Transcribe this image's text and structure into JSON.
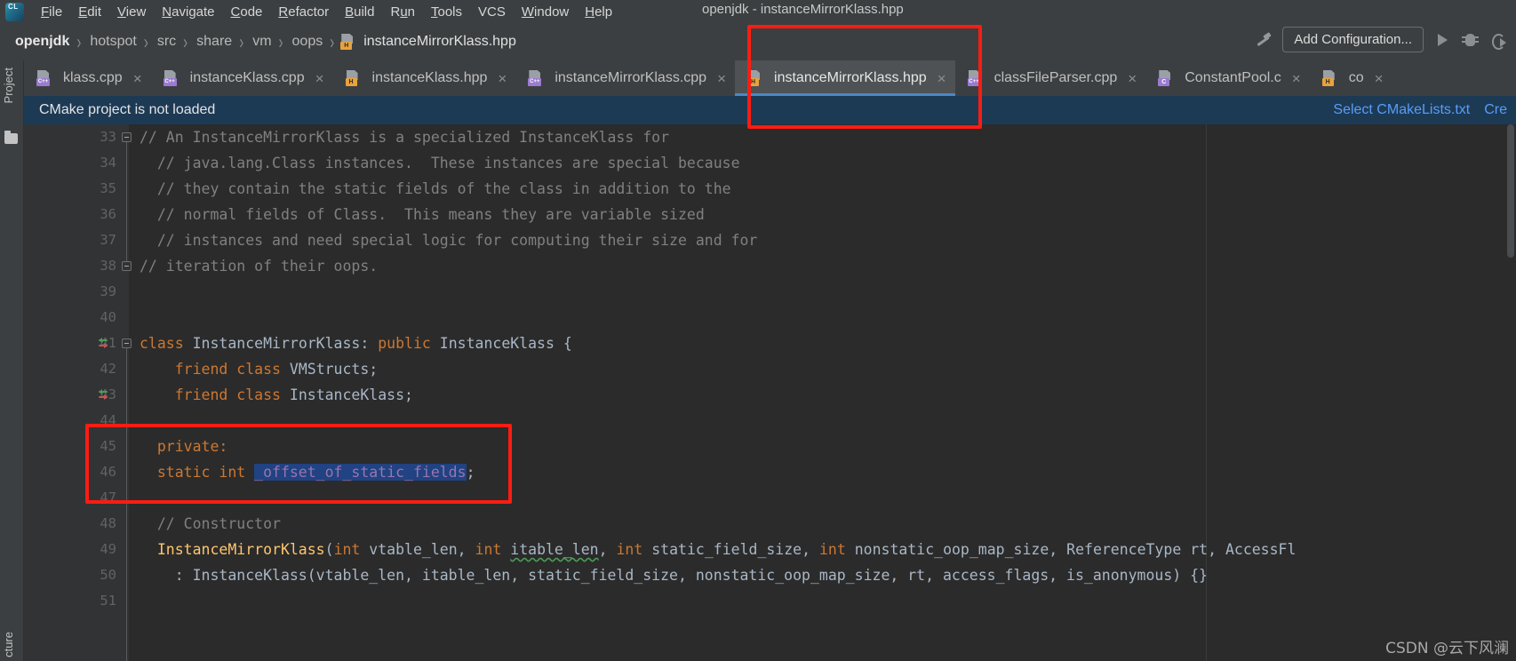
{
  "window": {
    "title": "openjdk - instanceMirrorKlass.hpp"
  },
  "menu": {
    "items": [
      {
        "label": "File",
        "mnemonic": "F"
      },
      {
        "label": "Edit",
        "mnemonic": "E"
      },
      {
        "label": "View",
        "mnemonic": "V"
      },
      {
        "label": "Navigate",
        "mnemonic": "N"
      },
      {
        "label": "Code",
        "mnemonic": "C"
      },
      {
        "label": "Refactor",
        "mnemonic": "R"
      },
      {
        "label": "Build",
        "mnemonic": "B"
      },
      {
        "label": "Run",
        "mnemonic": "u"
      },
      {
        "label": "Tools",
        "mnemonic": "T"
      },
      {
        "label": "VCS",
        "mnemonic": ""
      },
      {
        "label": "Window",
        "mnemonic": "W"
      },
      {
        "label": "Help",
        "mnemonic": "H"
      }
    ]
  },
  "breadcrumb": {
    "items": [
      "openjdk",
      "hotspot",
      "src",
      "share",
      "vm",
      "oops"
    ],
    "file": "instanceMirrorKlass.hpp",
    "separator": "›"
  },
  "toolbar": {
    "build_icon": "hammer-icon",
    "add_configuration": "Add Configuration...",
    "run_icon": "run-icon",
    "debug_icon": "debug-icon",
    "attach_icon": "attach-process-icon"
  },
  "tool_windows": {
    "project": "Project",
    "structure": "cture"
  },
  "tabs": [
    {
      "label": "klass.cpp",
      "type": "cpp",
      "active": false
    },
    {
      "label": "instanceKlass.cpp",
      "type": "cpp",
      "active": false
    },
    {
      "label": "instanceKlass.hpp",
      "type": "h",
      "active": false
    },
    {
      "label": "instanceMirrorKlass.cpp",
      "type": "cpp",
      "active": false
    },
    {
      "label": "instanceMirrorKlass.hpp",
      "type": "h",
      "active": true
    },
    {
      "label": "classFileParser.cpp",
      "type": "cpp",
      "active": false
    },
    {
      "label": "ConstantPool.c",
      "type": "c",
      "active": false
    },
    {
      "label": "co",
      "type": "h",
      "active": false
    }
  ],
  "notification": {
    "message": "CMake project is not loaded",
    "link_select": "Select CMakeLists.txt",
    "link_create": "Cre"
  },
  "editor": {
    "first_line_number": 33,
    "lines": [
      {
        "n": 33,
        "segments": [
          {
            "t": "// An InstanceMirrorKlass is a specialized InstanceKlass for",
            "c": "cmt"
          }
        ]
      },
      {
        "n": 34,
        "segments": [
          {
            "t": "  // java.lang.Class instances.  These instances are special because",
            "c": "cmt"
          }
        ]
      },
      {
        "n": 35,
        "segments": [
          {
            "t": "  // they contain the static fields of the class in addition to the",
            "c": "cmt"
          }
        ]
      },
      {
        "n": 36,
        "segments": [
          {
            "t": "  // normal fields of Class.  This means they are variable sized",
            "c": "cmt"
          }
        ]
      },
      {
        "n": 37,
        "segments": [
          {
            "t": "  // instances and need special logic for computing their size and for",
            "c": "cmt"
          }
        ]
      },
      {
        "n": 38,
        "segments": [
          {
            "t": "// iteration of their oops.",
            "c": "cmt"
          }
        ]
      },
      {
        "n": 39,
        "segments": []
      },
      {
        "n": 40,
        "segments": []
      },
      {
        "n": 41,
        "segments": [
          {
            "t": "class ",
            "c": "kw"
          },
          {
            "t": "InstanceMirrorKlass",
            "c": "cls"
          },
          {
            "t": ": ",
            "c": "pun"
          },
          {
            "t": "public ",
            "c": "kw"
          },
          {
            "t": "InstanceKlass {",
            "c": "cls"
          }
        ]
      },
      {
        "n": 42,
        "segments": [
          {
            "t": "    friend class ",
            "c": "kw"
          },
          {
            "t": "VMStructs;",
            "c": "cls"
          }
        ]
      },
      {
        "n": 43,
        "segments": [
          {
            "t": "    friend class ",
            "c": "kw"
          },
          {
            "t": "InstanceKlass;",
            "c": "cls"
          }
        ]
      },
      {
        "n": 44,
        "segments": []
      },
      {
        "n": 45,
        "segments": [
          {
            "t": "  private:",
            "c": "kw"
          }
        ]
      },
      {
        "n": 46,
        "segments": [
          {
            "t": "  static int ",
            "c": "kw"
          },
          {
            "t": "_offset_of_static_fields",
            "c": "fld sel"
          },
          {
            "t": ";",
            "c": "pun"
          }
        ]
      },
      {
        "n": 47,
        "segments": []
      },
      {
        "n": 48,
        "segments": [
          {
            "t": "  // Constructor",
            "c": "cmt"
          }
        ]
      },
      {
        "n": 49,
        "segments": [
          {
            "t": "  InstanceMirrorKlass",
            "c": "fn"
          },
          {
            "t": "(",
            "c": "pun"
          },
          {
            "t": "int",
            "c": "kw"
          },
          {
            "t": " vtable_len, ",
            "c": "pun"
          },
          {
            "t": "int",
            "c": "kw"
          },
          {
            "t": " ",
            "c": "pun"
          },
          {
            "t": "itable_len",
            "c": "pun sq"
          },
          {
            "t": ", ",
            "c": "pun"
          },
          {
            "t": "int",
            "c": "kw"
          },
          {
            "t": " static_field_size, ",
            "c": "pun"
          },
          {
            "t": "int",
            "c": "kw"
          },
          {
            "t": " nonstatic_oop_map_size, ReferenceType rt, AccessFl",
            "c": "pun"
          }
        ]
      },
      {
        "n": 50,
        "segments": [
          {
            "t": "    : InstanceKlass(vtable_len, itable_len, static_field_size, nonstatic_oop_map_size, rt, access_flags, is_anonymous) {}",
            "c": "pun"
          }
        ]
      },
      {
        "n": 51,
        "segments": []
      }
    ],
    "markers": {
      "fold_lines": [
        33,
        38,
        41
      ],
      "override_lines": [
        41,
        43
      ]
    }
  },
  "annotations": {
    "highlight_tab": "instanceMirrorKlass.hpp",
    "highlight_code": "private: static int _offset_of_static_fields;",
    "box_color": "#fc1c12"
  },
  "watermark": "CSDN @云下风澜",
  "colors": {
    "editor_bg": "#2b2b2b",
    "gutter_bg": "#313335",
    "chrome_bg": "#3c3f41",
    "notif_bg": "#1d3a55",
    "selection": "#214283",
    "accent_tab": "#4a88c7",
    "comment": "#808080",
    "keyword": "#cc7832",
    "function": "#ffc66d",
    "field": "#9876aa"
  }
}
